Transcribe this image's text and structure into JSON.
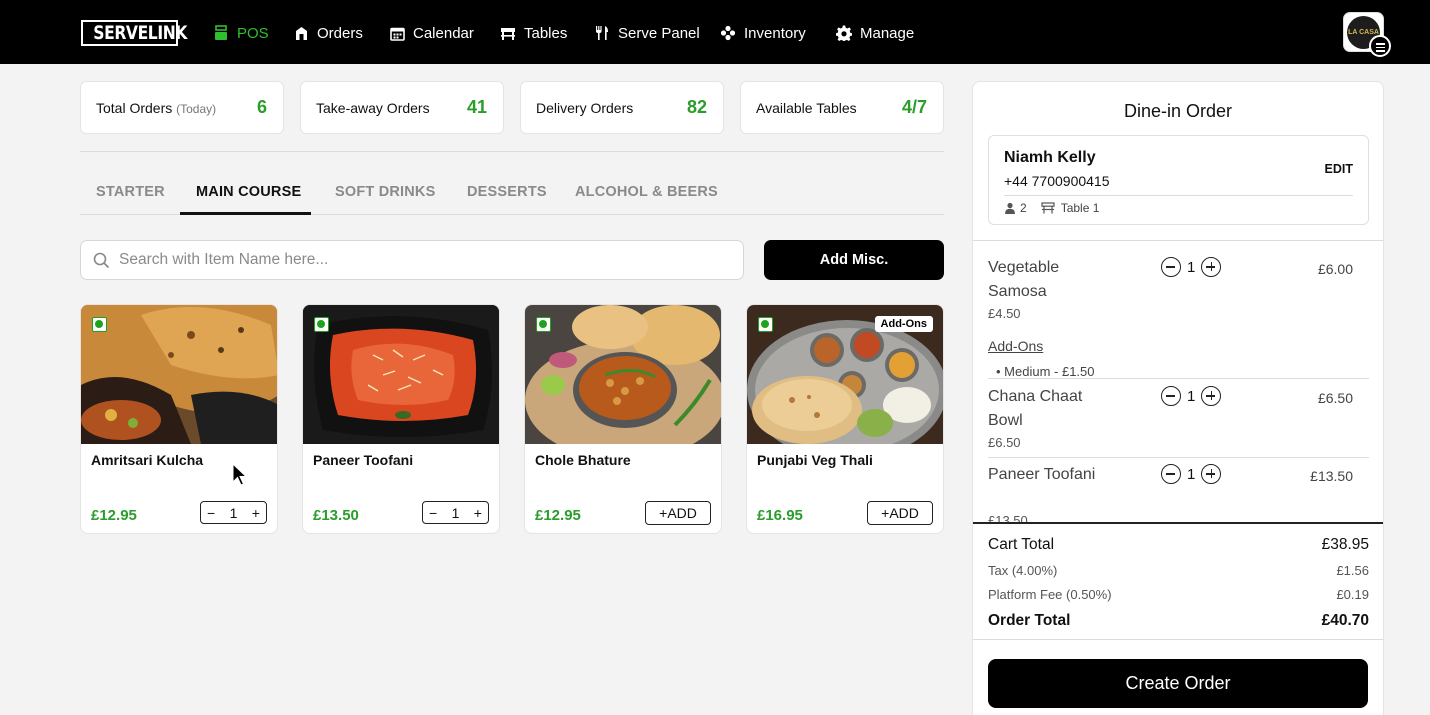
{
  "brand": {
    "logo_text": "SERVELINK",
    "avatar_text": "LA CASA"
  },
  "nav": {
    "items": [
      {
        "label": "POS",
        "icon": "pos-icon",
        "active": true
      },
      {
        "label": "Orders",
        "icon": "orders-icon"
      },
      {
        "label": "Calendar",
        "icon": "calendar-icon"
      },
      {
        "label": "Tables",
        "icon": "table-icon"
      },
      {
        "label": "Serve Panel",
        "icon": "fork-knife-icon"
      },
      {
        "label": "Inventory",
        "icon": "inventory-icon"
      },
      {
        "label": "Manage",
        "icon": "gear-icon"
      }
    ]
  },
  "stats": [
    {
      "label": "Total Orders",
      "sub": "(Today)",
      "value": "6"
    },
    {
      "label": "Take-away Orders",
      "sub": "",
      "value": "41"
    },
    {
      "label": "Delivery Orders",
      "sub": "",
      "value": "82"
    },
    {
      "label": "Available Tables",
      "sub": "",
      "value": "4/7"
    }
  ],
  "tabs": [
    {
      "label": "STARTER"
    },
    {
      "label": "MAIN COURSE",
      "active": true
    },
    {
      "label": "SOFT DRINKS"
    },
    {
      "label": "DESSERTS"
    },
    {
      "label": "ALCOHOL & BEERS"
    }
  ],
  "search": {
    "placeholder": "Search with Item Name here..."
  },
  "add_misc_label": "Add Misc.",
  "products": [
    {
      "name": "Amritsari Kulcha",
      "price": "£12.95",
      "qty": "1",
      "in_cart": true,
      "veg": true
    },
    {
      "name": "Paneer Toofani",
      "price": "£13.50",
      "qty": "1",
      "in_cart": true,
      "veg": true
    },
    {
      "name": "Chole Bhature",
      "price": "£12.95",
      "add_label": "ADD",
      "in_cart": false,
      "veg": true
    },
    {
      "name": "Punjabi Veg Thali",
      "price": "£16.95",
      "add_label": "ADD",
      "in_cart": false,
      "veg": true,
      "tag": "Add-Ons"
    }
  ],
  "order": {
    "title": "Dine-in Order",
    "customer": {
      "name": "Niamh Kelly",
      "phone": "+44 7700900415",
      "guests": "2",
      "table": "Table 1",
      "edit_label": "EDIT"
    },
    "items": [
      {
        "name": "Vegetable Samosa",
        "unit_price": "£4.50",
        "qty": "1",
        "total": "£6.00",
        "addons_label": "Add-Ons",
        "addon": "Medium - £1.50"
      },
      {
        "name": "Chana Chaat Bowl",
        "unit_price": "£6.50",
        "qty": "1",
        "total": "£6.50"
      },
      {
        "name": "Paneer Toofani",
        "unit_price": "£13.50",
        "qty": "1",
        "total": "£13.50"
      }
    ],
    "totals": {
      "cart_total_label": "Cart Total",
      "cart_total": "£38.95",
      "tax_label": "Tax (4.00%)",
      "tax": "£1.56",
      "fee_label": "Platform Fee (0.50%)",
      "fee": "£0.19",
      "order_total_label": "Order Total",
      "order_total": "£40.70"
    },
    "create_label": "Create Order"
  },
  "colors": {
    "accent_green": "#2a9d2a",
    "nav_bg": "#000000",
    "veg_green": "#1fa21f"
  }
}
